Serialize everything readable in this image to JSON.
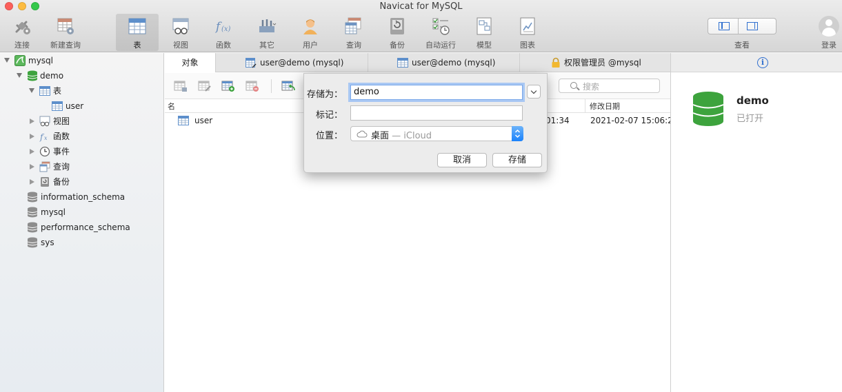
{
  "window": {
    "title": "Navicat for MySQL"
  },
  "toolbar": {
    "items": [
      {
        "label": "连接",
        "icon": "connect-icon"
      },
      {
        "label": "新建查询",
        "icon": "new-query-icon"
      },
      {
        "label": "表",
        "icon": "table-icon",
        "active": true
      },
      {
        "label": "视图",
        "icon": "view-icon"
      },
      {
        "label": "函数",
        "icon": "function-icon"
      },
      {
        "label": "其它",
        "icon": "tools-icon"
      },
      {
        "label": "用户",
        "icon": "user-icon"
      },
      {
        "label": "查询",
        "icon": "query-icon"
      },
      {
        "label": "备份",
        "icon": "backup-icon"
      },
      {
        "label": "自动运行",
        "icon": "automation-icon"
      },
      {
        "label": "模型",
        "icon": "model-icon"
      },
      {
        "label": "图表",
        "icon": "chart-icon"
      }
    ],
    "view_label": "查看",
    "login_label": "登录"
  },
  "sidebar": {
    "connection": "mysql",
    "database": "demo",
    "groups": {
      "tables": "表",
      "table_user": "user",
      "views": "视图",
      "functions": "函数",
      "events": "事件",
      "queries": "查询",
      "backups": "备份"
    },
    "other_dbs": [
      "information_schema",
      "mysql",
      "performance_schema",
      "sys"
    ]
  },
  "tabs": [
    {
      "label": "对象",
      "active": true
    },
    {
      "label": "user@demo (mysql)"
    },
    {
      "label": "user@demo (mysql)"
    },
    {
      "label": "权限管理员 @mysql"
    }
  ],
  "search": {
    "placeholder": "搜索"
  },
  "list": {
    "col_name": "名",
    "col_modified": "修改日期",
    "rows": [
      {
        "name": "user",
        "partial_time": "01:34",
        "modified": "2021-02-07 15:06:2"
      }
    ]
  },
  "right_panel": {
    "db_name": "demo",
    "status": "已打开"
  },
  "save_dialog": {
    "save_as_label": "存储为：",
    "save_as_value": "demo",
    "tags_label": "标记：",
    "tags_value": "",
    "location_label": "位置：",
    "location_value": "桌面",
    "location_sub": "— iCloud",
    "cancel_label": "取消",
    "save_label": "存储"
  },
  "colors": {
    "accent": "#2f6fcf",
    "db_green": "#3da33d",
    "stepper_blue": "#1a82fb"
  }
}
